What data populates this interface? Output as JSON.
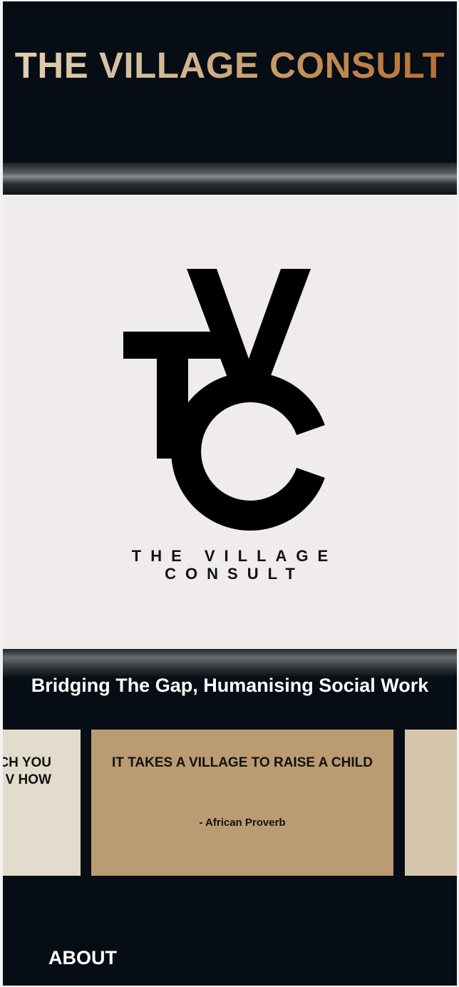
{
  "header": {
    "title": "THE VILLAGE CONSULT"
  },
  "logo": {
    "monogram_icon": "tvc-monogram-icon",
    "line1": "THE VILLAGE",
    "line2": "CONSULT"
  },
  "tagline": "Bridging The Gap, Humanising Social Work",
  "carousel": {
    "prev_card": {
      "line1": "CH YOU",
      "line2": "V HOW"
    },
    "current_card": {
      "quote": "IT TAKES A VILLAGE TO RAISE A CHILD",
      "attribution": "- African Proverb"
    }
  },
  "nav": {
    "about": "ABOUT"
  },
  "colors": {
    "background": "#060d14",
    "title_gradient_start": "#e2d0b4",
    "title_gradient_end": "#b46c33",
    "hero_bg": "#efeceb",
    "card_left": "#e2dccd",
    "card_main": "#bb9b72",
    "card_right": "#d6c6ae"
  }
}
